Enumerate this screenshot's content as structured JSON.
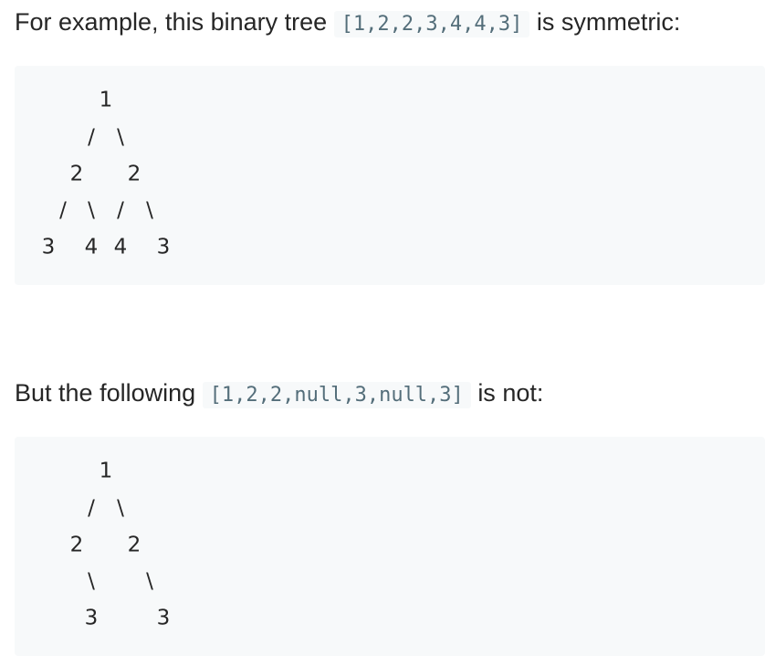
{
  "example1": {
    "prefix": "For example, this binary tree",
    "code": "[1,2,2,3,4,4,3]",
    "suffix": "is symmetric:",
    "tree_rows": [
      [
        "1"
      ],
      [
        "/",
        "\\"
      ],
      [
        "2",
        "2"
      ],
      [
        "/",
        "\\",
        "/",
        "\\"
      ],
      [
        "3",
        "4",
        "4",
        "3"
      ]
    ]
  },
  "example2": {
    "prefix": "But the following",
    "code": "[1,2,2,null,3,null,3]",
    "suffix": "is not:",
    "tree_rows": [
      [
        "1"
      ],
      [
        "/",
        "\\"
      ],
      [
        "2",
        "2"
      ],
      [
        "\\",
        "\\"
      ],
      [
        "3",
        "3"
      ]
    ]
  }
}
